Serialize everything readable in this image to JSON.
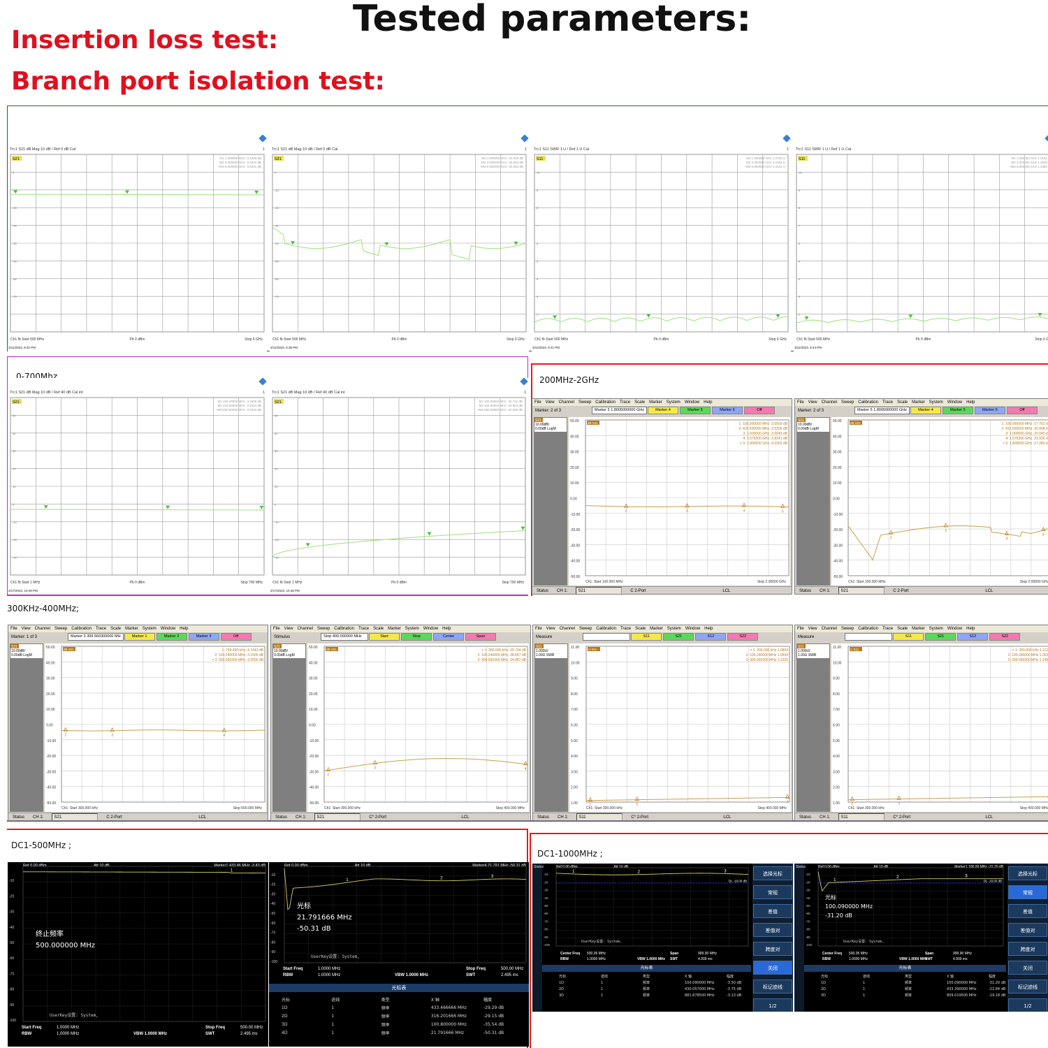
{
  "title": "Tested parameters:",
  "heading_insertion": "Insertion loss test:",
  "heading_isolation": "Branch port isolation test:",
  "sections": {
    "s2_label": "0-700Mhz",
    "s3_label": "200MHz-2GHz",
    "s4_label": "300KHz-400MHz;",
    "s5a_label": "DC1-500MHz ;",
    "s5b_label": "DC1-1000MHz ;"
  },
  "colors": {
    "accent_red": "#e0101e",
    "frame_green": "#1f6b1f",
    "frame_magenta": "#c22ac2",
    "frame_red": "#e01c1c",
    "trace_green": "#9fe07a",
    "trace_gold": "#c8a04a"
  },
  "vna_row1": [
    {
      "header": "Trc1  S21  dB Mag  10 dB /  Ref 0 dB   Cal",
      "param": "S21",
      "markers": [
        "M1   1.000000  GHz   -3.1400  dB",
        "M2   3.000000  GHz   -3.4044  dB",
        "•M3   5.900000  GHz   -3.6401  dB"
      ],
      "footer_l": "Ch1  fb  Start  500 MHz",
      "footer_m": "Pb  0 dBm",
      "footer_r": "Stop  6 GHz",
      "date": "3/11/2023, 8:32 PM",
      "yticks": [
        "0",
        "-10",
        "-20",
        "-30",
        "-40",
        "-50",
        "-60",
        "-70"
      ]
    },
    {
      "header": "Trc1  S21  dB Mag  10 dB /  Ref 0 dB   Cal",
      "param": "S21",
      "markers": [
        "M1   1.000000  GHz   -25.000  dB",
        "M2   3.000000  GHz   -26.663  dB",
        "•M3   5.900000  GHz   -25.363  dB"
      ],
      "footer_l": "Ch1  fb  Start  500 MHz",
      "footer_m": "Pb  0 dBm",
      "footer_r": "Stop  6 GHz",
      "date": "3/11/2023, 8:38 PM",
      "yticks": [
        "0",
        "-10",
        "-20",
        "-30",
        "-40",
        "-50",
        "-60",
        "-70"
      ]
    },
    {
      "header": "Trc1  S11  SWR  1 U /  Ref 1 U   Cal",
      "param": "S11",
      "markers": [
        "M1   1.000000  GHz   1.0759  U",
        "M2   3.000000  GHz   1.2264  U",
        "•M3   5.900000  GHz   1.4122  U"
      ],
      "footer_l": "Ch1  fb  Start  500 MHz",
      "footer_m": "Pb  0 dBm",
      "footer_r": "Stop  6 GHz",
      "date": "3/11/2023, 8:41 PM",
      "yticks": [
        "10",
        "9",
        "8",
        "7",
        "6",
        "5",
        "4",
        "3",
        "2"
      ]
    },
    {
      "header": "Trc1  S11  SWR  1 U /  Ref 1 U   Cal",
      "param": "S11",
      "markers": [
        "M1   1.000000  GHz   1.0151",
        "M2   3.000000  GHz   1.0638",
        "•M3   5.900000  GHz   1.2082"
      ],
      "footer_l": "Ch1  fb  Start  500 MHz",
      "footer_m": "Pb  0 dBm",
      "footer_r": "Stop  6 G",
      "date": "3/11/2023, 8:44 PM",
      "yticks": [
        "10",
        "9",
        "8",
        "7",
        "6",
        "5",
        "4",
        "3",
        "2"
      ]
    }
  ],
  "vna_row2": [
    {
      "header": "Trc1  S21  dB Mag  10 dB /  Ref 40 dB   Cal int",
      "param": "S21",
      "markers": [
        "M1   100.30000  MHz   -3.1506  dB",
        "M2   433.00000  MHz   -3.2524  dB",
        "•M3   690.50000  MHz   -3.5334  dB"
      ],
      "footer_l": "Ch1  fb  Start  1 MHz",
      "footer_m": "Pb  0 dBm",
      "footer_r": "Stop  700 MHz",
      "date": "2/17/2023, 10:49 PM",
      "yticks": [
        "50",
        "40",
        "30",
        "20",
        "10",
        "0",
        "-10",
        "-20",
        "-30"
      ]
    },
    {
      "header": "Trc1  S21  dB Mag  10 dB /  Ref 40 dB   Cal int",
      "param": "S21",
      "markers": [
        "M1   100.30000  MHz   -32.741  dB",
        "M2   433.00000  MHz   -22.904  dB",
        "•M3   690.50000  MHz   -20.950  dB"
      ],
      "footer_l": "Ch1  fb  Start  1 MHz",
      "footer_m": "Pb  0 dBm",
      "footer_r": "Stop  700 MHz",
      "date": "2/17/2023, 10:48 PM",
      "yticks": [
        "50",
        "40",
        "30",
        "20",
        "10",
        "0",
        "-10",
        "-20",
        "-30"
      ]
    }
  ],
  "pna_menu": [
    "File",
    "View",
    "Channel",
    "Sweep",
    "Calibration",
    "Trace",
    "Scale",
    "Marker",
    "System",
    "Window",
    "Help"
  ],
  "pna_row3": [
    {
      "left": "Marker: 2 of 3",
      "field": "Marker 5  1.8005000000 GHz",
      "btns": [
        "Marker 4",
        "Marker 5",
        "Marker 6",
        "Off"
      ],
      "scale": "S21\n10.00dB/\n0.00dB  LogM",
      "trace": "dB S21",
      "markers": [
        "1:  100.000000 MHz   -3.6509 dB",
        "2:  432.500000 MHz   -3.5296 dB",
        "3:  1.000000 GHz   -3.5645 dB",
        "4:  1.576300 GHz   -3.8241 dB",
        "> 5:  1.800500 GHz   -4.2303 dB"
      ],
      "start": "Ch1: Start  100.000 MHz",
      "stop": "Stop  2.00000 GHz",
      "status": [
        "Status",
        "CH 1:",
        "S21",
        "C  2-Port",
        "LCL"
      ],
      "yticks": [
        "50.00",
        "40.00",
        "30.00",
        "20.00",
        "10.00",
        "0.00",
        "-10.00",
        "-20.00",
        "-30.00",
        "-40.00",
        "-50.00"
      ]
    },
    {
      "left": "Marker: 2 of 3",
      "field": "Marker 5  1.8005000000 GHz",
      "btns": [
        "Marker 4",
        "Marker 5",
        "Marker 6",
        "Off"
      ],
      "scale": "S21\n10.00dB/\n0.00dB  LogM",
      "trace": "dB S21",
      "markers": [
        "1:  100.000000 MHz   -17.762 dB",
        "2:  432.500000 MHz   -30.908 dB",
        "3:  1.000000 GHz   -20.045 dB",
        "4:  1.576300 GHz   -23.936 dB",
        "> 5:  1.800500 GHz   -17.280 dB"
      ],
      "start": "Ch1: Start  100.000 MHz",
      "stop": "Stop  2.00000 GHz",
      "status": [
        "Status",
        "CH 1:",
        "S21",
        "C  2-Port",
        "LCL"
      ],
      "yticks": [
        "50.00",
        "40.00",
        "30.00",
        "20.00",
        "10.00",
        "0.00",
        "-10.00",
        "-20.00",
        "-30.00",
        "-40.00",
        "-50.00"
      ]
    }
  ],
  "pna_row4": [
    {
      "left": "Marker: 1 of 3",
      "field": "Marker 3  399.560300000 MH",
      "btns": [
        "Marker 1",
        "Marker 2",
        "Marker 3",
        "Off"
      ],
      "scale": "S21\n10.00dB/\n0.00dB  LogM",
      "trace": "dB S21",
      "markers": [
        "1:  799.400 kHz   -4.1443 dB",
        "2:  100.240000 MHz   -3.1566 dB",
        "> 3:  399.560300 MHz   -3.2566 dB"
      ],
      "start": "Ch1: Start  300.000 kHz",
      "stop": "Stop  500.000 MHz",
      "status": [
        "Status",
        "CH 1:",
        "S21",
        "C  2-Port",
        "LCL"
      ],
      "yticks": [
        "50.00",
        "40.00",
        "30.00",
        "20.00",
        "10.00",
        "0.00",
        "-10.00",
        "-20.00",
        "-30.00",
        "-40.00",
        "-50.00"
      ]
    },
    {
      "left": "Stimulus",
      "field": "Stop  400.000000 MHz",
      "btns": [
        "Start",
        "Stop",
        "Center",
        "Span"
      ],
      "scale": "S21\n10.00dB/\n0.00dB  LogM",
      "trace": "dB S21",
      "markers": [
        "> 1:  300.000 kHz   -29.704 dB",
        "2:  100.240000 MHz   -28.667 dB",
        "3:  399.560300 MHz   -24.487 dB"
      ],
      "start": "Ch1: Start  300.000 kHz",
      "stop": "Stop  400.000 MHz",
      "status": [
        "Status",
        "CH 1:",
        "S21",
        "C* 2-Port",
        "LCL"
      ],
      "yticks": [
        "50.00",
        "40.00",
        "30.00",
        "20.00",
        "10.00",
        "0.00",
        "-10.00",
        "-20.00",
        "-30.00",
        "-40.00",
        "-50.00"
      ]
    },
    {
      "left": "Measure",
      "field": "",
      "btns": [
        "S11",
        "S21",
        "S12",
        "S22"
      ],
      "scale": "S11\n1.000U/\n1.00U   SWR",
      "trace": "U S11",
      "markers": [
        "> 1:  300.000 kHz   1.0804",
        "2:  100.240000 MHz   1.0544",
        "3:  399.560300 MHz   1.1326"
      ],
      "start": "Ch1: Start  300.000 kHz",
      "stop": "Stop  400.000 MHz",
      "status": [
        "Status",
        "CH 1:",
        "S11",
        "C* 2-Port",
        "LCL"
      ],
      "yticks": [
        "11.00",
        "10.00",
        "9.00",
        "8.00",
        "7.00",
        "6.00",
        "5.00",
        "4.00",
        "3.00",
        "2.00",
        "1.00"
      ]
    },
    {
      "left": "Measure",
      "field": "",
      "btns": [
        "S11",
        "S21",
        "S12",
        "S22"
      ],
      "scale": "S11\n1.000U/\n1.00U   SWR",
      "trace": "U S11",
      "markers": [
        "> 1:  300.000 kHz   1.1120",
        "2:  100.240000 MHz   1.0638",
        "3:  399.560300 MHz   1.1492"
      ],
      "start": "Ch1: Start  300.000 kHz",
      "stop": "Stop  400.000 MHz",
      "status": [
        "Status",
        "CH 1:",
        "S11",
        "C* 2-Port",
        "LCL"
      ],
      "yticks": [
        "11.00",
        "10.00",
        "9.00",
        "8.00",
        "7.00",
        "6.00",
        "5.00",
        "4.00",
        "3.00",
        "2.00",
        "1.00"
      ]
    }
  ],
  "sa_row5": [
    {
      "ref": "Ref  0.00 dBm",
      "att": "Att    10 dB",
      "mkr": "Marker1   433.46 MHz   -3.43 dB",
      "overlay1": "终止频率",
      "overlay2": "500.000000 MHz",
      "userkey": "UserKey设置:   System,",
      "sf": "Start Freq",
      "sfv": "1.0000 MHz",
      "rbw": "RBW",
      "rbwv": "1.0000 MHz",
      "vbw": "VBW   1.0000 MHz",
      "stop": "Stop Freq",
      "stopv": "500.00 MHz",
      "swt": "SWT",
      "swtv": "2.495 ms",
      "yticks": [
        "-10",
        "-20",
        "-30",
        "-40",
        "-50",
        "-60",
        "-70",
        "-80",
        "-90",
        "-100"
      ]
    },
    {
      "ref": "Ref  0.00 dBm",
      "att": "Att    10 dB",
      "mkr": "Marker4   21.791 MHz   -50.31 dB",
      "overlay1": "光标",
      "overlay2": "21.791666 MHz",
      "overlay3": "-50.31 dB",
      "userkey": "UserKey设置:   System,",
      "sf": "Start Freq",
      "sfv": "1.0000 MHz",
      "rbw": "RBW",
      "rbwv": "1.0000 MHz",
      "vbw": "VBW   1.0000 MHz",
      "stop": "Stop Freq",
      "stopv": "500.00 MHz",
      "swt": "SWT",
      "swtv": "2.495 ms",
      "table_title": "光标表",
      "table_head": [
        "光标",
        "迹线",
        "类型",
        "X 轴",
        "幅度"
      ],
      "rows": [
        [
          "1D",
          "1",
          "频率",
          "433.466666 MHz",
          "-29.29 dB"
        ],
        [
          "2D",
          "1",
          "频率",
          "316.201666 MHz",
          "-29.15 dB"
        ],
        [
          "3D",
          "1",
          "频率",
          "100.800000 MHz",
          "-35.54 dB"
        ],
        [
          "4D",
          "1",
          "频率",
          "21.791666 MHz",
          "-50.31 dB"
        ]
      ],
      "yticks": [
        "-10",
        "-20",
        "-30",
        "-40",
        "-50",
        "-60",
        "-70",
        "-80",
        "-90",
        "-100"
      ]
    }
  ],
  "sa_row5b": [
    {
      "status": "Status",
      "ref": "Ref  0.00 dBm",
      "att": "Att   10 dB",
      "mkr": "",
      "dl": "DL -19.00 dB",
      "userkey": "UserKey设置:  System,",
      "cf": "Center Freq",
      "cfv": "500.05 MHz",
      "span": "Span",
      "spanv": "999.90 MHz",
      "rbw": "RBW",
      "rbwv": "1.0000 MHz",
      "vbw": "VBW   1.0000 MHz",
      "swt": "SWT",
      "swtv": "4.999 ms",
      "table_title": "光标表",
      "table_head": [
        "光标",
        "迹线",
        "类型",
        "X 轴",
        "幅度"
      ],
      "rows": [
        [
          "1D",
          "1",
          "频率",
          "100.090000 MHz",
          "-3.50 dB"
        ],
        [
          "2D",
          "1",
          "频率",
          "430.057000 MHz",
          "-3.75 dB"
        ],
        [
          "3D",
          "1",
          "频率",
          "881.678500 MHz",
          "-3.13 dB"
        ]
      ],
      "side": [
        "选择光标",
        "常规",
        "差值",
        "差值对",
        "跨度对",
        "关闭",
        "标记迹线",
        "1/2"
      ]
    },
    {
      "status": "Status",
      "ref": "Ref  0.00 dBm",
      "att": "Att   10 dB",
      "mkr": "Marker1   100.09 MHz   -31.20 dB",
      "dl": "DL -19.00 dB",
      "overlay1": "光标",
      "overlay2": "100.090000 MHz",
      "overlay3": "-31.20 dB",
      "userkey": "UserKey设置:  System,",
      "cf": "Center Freq",
      "cfv": "500.05 MHz",
      "span": "Span",
      "spanv": "999.90 MHz",
      "rbw": "RBW",
      "rbwv": "1.0000 MHz",
      "vbw": "VBW   1.0000 MHz",
      "swt": "SWT",
      "swtv": "4.999 ms",
      "table_title": "光标表",
      "table_head": [
        "光标",
        "迹线",
        "类型",
        "X 轴",
        "幅度"
      ],
      "rows": [
        [
          "1D",
          "1",
          "频率",
          "100.090000 MHz",
          "-31.20 dB"
        ],
        [
          "2D",
          "1",
          "频率",
          "433.390000 MHz",
          "-21.84 dB"
        ],
        [
          "3D",
          "1",
          "频率",
          "809.019500 MHz",
          "-19.18 dB"
        ]
      ],
      "side": [
        "选择光标",
        "常规",
        "差值",
        "差值对",
        "跨度对",
        "关闭",
        "标记迹线",
        "1/2"
      ]
    }
  ]
}
